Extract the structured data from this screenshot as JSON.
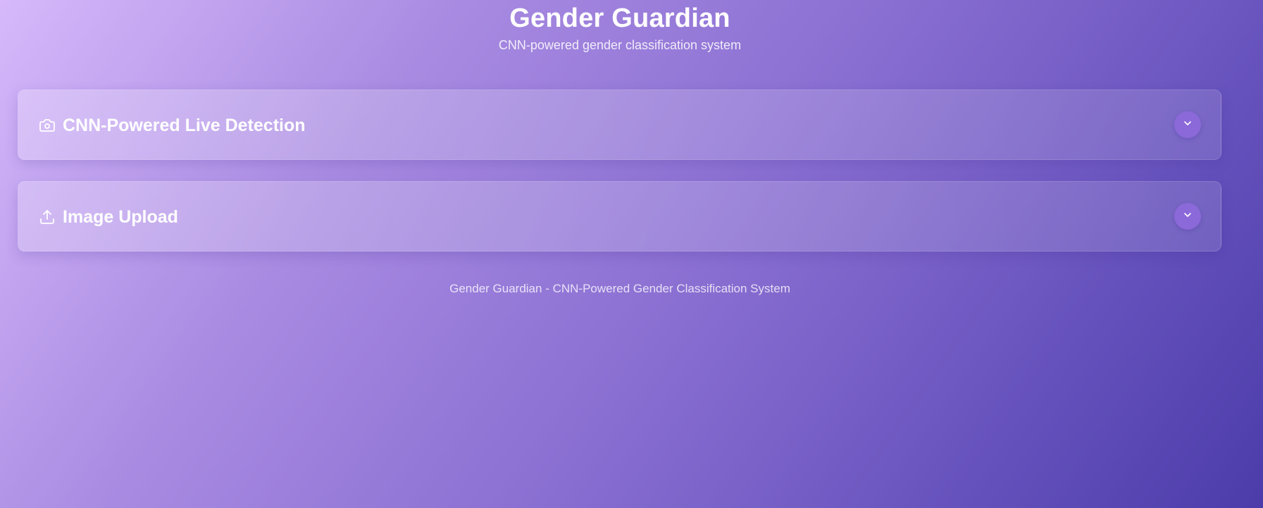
{
  "header": {
    "title": "Gender Guardian",
    "subtitle": "CNN-powered gender classification system"
  },
  "panels": [
    {
      "title": "CNN-Powered Live Detection",
      "icon": "camera-icon",
      "expanded": false
    },
    {
      "title": "Image Upload",
      "icon": "upload-icon",
      "expanded": false
    }
  ],
  "footer": {
    "text": "Gender Guardian - CNN-Powered Gender Classification System"
  },
  "colors": {
    "chevron_button": "#8b69d9",
    "gradient_start": "#d6b8fb",
    "gradient_end": "#4b3caa"
  }
}
